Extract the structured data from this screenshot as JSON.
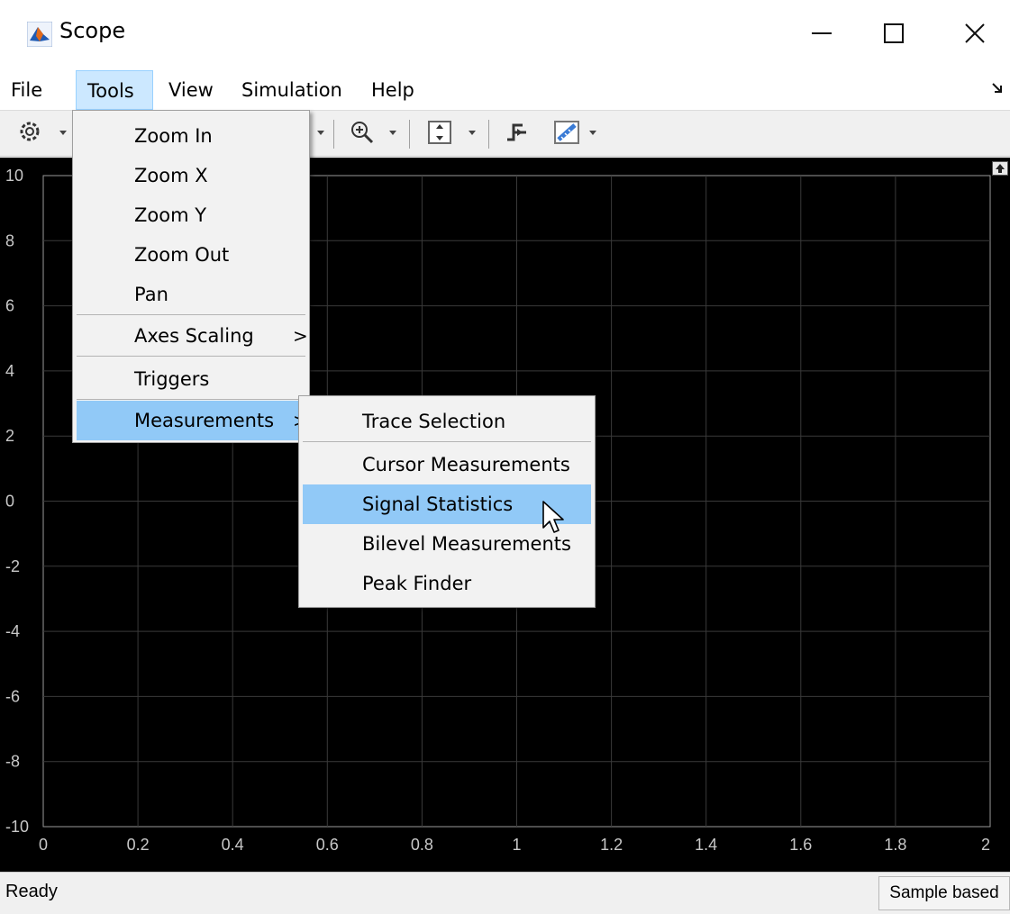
{
  "window": {
    "title": "Scope",
    "minimize_glyph": "—",
    "maximize_glyph": "☐",
    "close_glyph": "✕"
  },
  "menubar": {
    "items": [
      "File",
      "Tools",
      "View",
      "Simulation",
      "Help"
    ],
    "active": "Tools"
  },
  "tools_menu": {
    "items": [
      "Zoom In",
      "Zoom X",
      "Zoom Y",
      "Zoom Out",
      "Pan",
      "Axes Scaling",
      "Triggers",
      "Measurements"
    ],
    "highlighted": "Measurements",
    "submenu_chevron": ">"
  },
  "measurements_menu": {
    "items": [
      "Trace Selection",
      "Cursor Measurements",
      "Signal Statistics",
      "Bilevel Measurements",
      "Peak Finder"
    ],
    "highlighted": "Signal Statistics"
  },
  "toolbar": {
    "icons": [
      "settings-gear-icon",
      "zoom-in-icon",
      "autoscale-icon",
      "trigger-icon",
      "measure-ruler-icon"
    ]
  },
  "plot": {
    "background": "#000000",
    "grid_color": "#3a3a3a",
    "text_color": "#c8c8c8",
    "x_ticks": [
      "0",
      "0.2",
      "0.4",
      "0.6",
      "0.8",
      "1",
      "1.2",
      "1.4",
      "1.6",
      "1.8",
      "2"
    ],
    "y_ticks": [
      "10",
      "8",
      "6",
      "4",
      "2",
      "0",
      "-2",
      "-4",
      "-6",
      "-8",
      "-10"
    ]
  },
  "status": {
    "left": "Ready",
    "right": "Sample based"
  },
  "colors": {
    "menu_active_bg": "#cce8ff",
    "menu_highlight_bg": "#91c9f7",
    "app_icon_blue": "#1f5bb4",
    "app_icon_orange": "#e06a1c"
  }
}
